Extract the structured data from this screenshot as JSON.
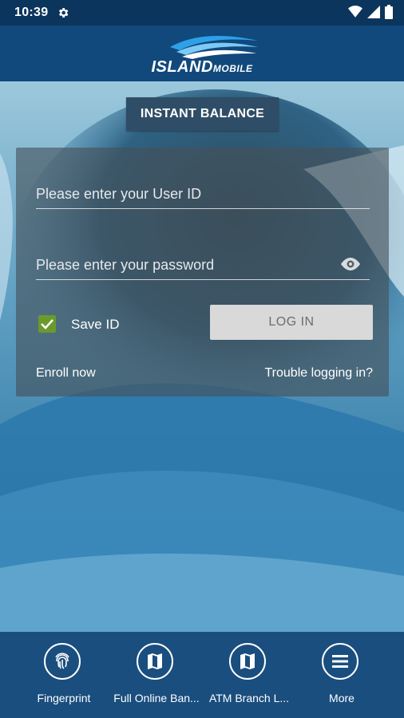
{
  "status": {
    "time": "10:39"
  },
  "header": {
    "logo_main": "ISLAND",
    "logo_sub": "MOBILE"
  },
  "instant_balance_label": "INSTANT BALANCE",
  "login": {
    "user_id_placeholder": "Please enter your User ID",
    "password_placeholder": "Please enter your password",
    "save_id_label": "Save ID",
    "save_id_checked": true,
    "login_button": "LOG IN",
    "enroll_link": "Enroll now",
    "trouble_link": "Trouble logging in?"
  },
  "bottom_nav": [
    {
      "label": "Fingerprint",
      "icon": "fingerprint-icon"
    },
    {
      "label": "Full Online Ban...",
      "icon": "map-icon"
    },
    {
      "label": "ATM Branch L...",
      "icon": "map-icon"
    },
    {
      "label": "More",
      "icon": "menu-icon"
    }
  ],
  "colors": {
    "status_bar": "#0b355c",
    "header": "#11497c",
    "accent_check": "#6a9a2c",
    "bottom_nav": "#1a4e7e"
  }
}
